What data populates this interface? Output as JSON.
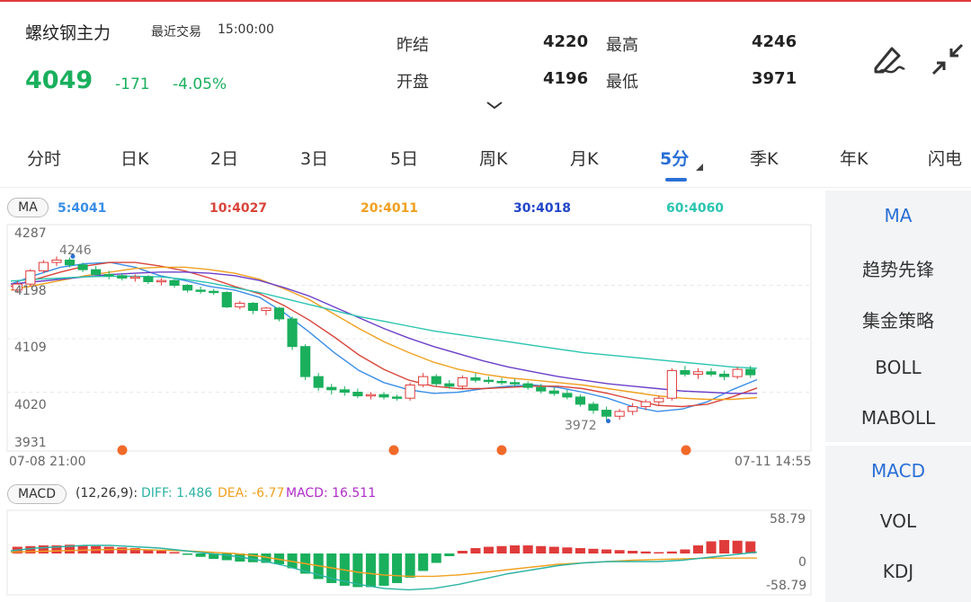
{
  "header": {
    "name": "螺纹钢主力",
    "last_trade_label": "最近交易",
    "time": "15:00:00",
    "price": "4049",
    "change": "-171",
    "change_pct": "-4.05%",
    "stats": [
      {
        "label": "昨结",
        "value": "4220"
      },
      {
        "label": "最高",
        "value": "4246"
      },
      {
        "label": "开盘",
        "value": "4196"
      },
      {
        "label": "最低",
        "value": "3971"
      }
    ],
    "colors": {
      "down": "#1aaf5d",
      "up": "#e03b3b",
      "accent": "#2a6fd6"
    },
    "icons": [
      "draw-pen-icon",
      "collapse-arrows-icon",
      "chevron-down-icon"
    ]
  },
  "tabs": [
    {
      "label": "分时"
    },
    {
      "label": "日K"
    },
    {
      "label": "2日"
    },
    {
      "label": "3日"
    },
    {
      "label": "5日"
    },
    {
      "label": "周K"
    },
    {
      "label": "月K"
    },
    {
      "label": "5分",
      "active": true
    },
    {
      "label": "季K"
    },
    {
      "label": "年K"
    },
    {
      "label": "闪电"
    }
  ],
  "ma_bar": {
    "pill": "MA",
    "values": [
      {
        "label": "5:4041",
        "color": "#3a8ee6"
      },
      {
        "label": "10:4027",
        "color": "#d8453a"
      },
      {
        "label": "20:4011",
        "color": "#f0a020"
      },
      {
        "label": "30:4018",
        "color": "#2246c8"
      },
      {
        "label": "60:4060",
        "color": "#2bc4b0"
      }
    ]
  },
  "chart_data": [
    {
      "type": "candlestick",
      "y_ticks": [
        "4287",
        "4198",
        "4109",
        "4020",
        "3931"
      ],
      "ylim": [
        3931,
        4287
      ],
      "x_start": "07-08 21:00",
      "x_end": "07-11 14:55",
      "annotations": {
        "high": "4246",
        "low": "3972"
      },
      "ohlc": [
        [
          4190,
          4205,
          4185,
          4200
        ],
        [
          4200,
          4225,
          4196,
          4222
        ],
        [
          4222,
          4240,
          4218,
          4236
        ],
        [
          4236,
          4246,
          4230,
          4240
        ],
        [
          4240,
          4244,
          4228,
          4232
        ],
        [
          4232,
          4236,
          4220,
          4224
        ],
        [
          4224,
          4230,
          4214,
          4216
        ],
        [
          4216,
          4222,
          4208,
          4214
        ],
        [
          4214,
          4218,
          4206,
          4210
        ],
        [
          4210,
          4216,
          4204,
          4212
        ],
        [
          4212,
          4215,
          4200,
          4204
        ],
        [
          4204,
          4210,
          4198,
          4206
        ],
        [
          4206,
          4208,
          4194,
          4198
        ],
        [
          4198,
          4200,
          4186,
          4190
        ],
        [
          4190,
          4196,
          4184,
          4188
        ],
        [
          4188,
          4192,
          4182,
          4186
        ],
        [
          4186,
          4188,
          4160,
          4162
        ],
        [
          4162,
          4172,
          4158,
          4168
        ],
        [
          4168,
          4170,
          4150,
          4156
        ],
        [
          4156,
          4162,
          4148,
          4160
        ],
        [
          4160,
          4162,
          4138,
          4142
        ],
        [
          4142,
          4146,
          4090,
          4096
        ],
        [
          4096,
          4100,
          4040,
          4046
        ],
        [
          4046,
          4052,
          4022,
          4028
        ],
        [
          4028,
          4034,
          4016,
          4024
        ],
        [
          4024,
          4030,
          4014,
          4020
        ],
        [
          4020,
          4026,
          4010,
          4014
        ],
        [
          4014,
          4020,
          4008,
          4016
        ],
        [
          4016,
          4020,
          4008,
          4012
        ],
        [
          4012,
          4016,
          4006,
          4010
        ],
        [
          4010,
          4036,
          4006,
          4032
        ],
        [
          4032,
          4052,
          4028,
          4046
        ],
        [
          4046,
          4050,
          4030,
          4034
        ],
        [
          4034,
          4040,
          4026,
          4030
        ],
        [
          4030,
          4048,
          4024,
          4044
        ],
        [
          4044,
          4052,
          4036,
          4040
        ],
        [
          4040,
          4046,
          4034,
          4038
        ],
        [
          4038,
          4044,
          4032,
          4036
        ],
        [
          4036,
          4042,
          4030,
          4034
        ],
        [
          4034,
          4038,
          4024,
          4028
        ],
        [
          4028,
          4034,
          4018,
          4022
        ],
        [
          4022,
          4028,
          4014,
          4018
        ],
        [
          4018,
          4024,
          4008,
          4012
        ],
        [
          4012,
          4016,
          3996,
          4000
        ],
        [
          4000,
          4004,
          3984,
          3990
        ],
        [
          3990,
          3996,
          3972,
          3980
        ],
        [
          3980,
          3992,
          3974,
          3988
        ],
        [
          3988,
          4002,
          3982,
          3996
        ],
        [
          3996,
          4008,
          3990,
          4004
        ],
        [
          4004,
          4014,
          3998,
          4010
        ],
        [
          4010,
          4060,
          4006,
          4056
        ],
        [
          4056,
          4064,
          4046,
          4050
        ],
        [
          4050,
          4060,
          4042,
          4054
        ],
        [
          4054,
          4060,
          4046,
          4050
        ],
        [
          4050,
          4056,
          4040,
          4046
        ],
        [
          4046,
          4062,
          4042,
          4058
        ],
        [
          4058,
          4064,
          4044,
          4049
        ]
      ],
      "ma": {
        "ma5": [
          4200,
          4215,
          4228,
          4234,
          4236,
          4228,
          4214,
          4206,
          4196,
          4190,
          4178,
          4152,
          4120,
          4086,
          4056,
          4036,
          4024,
          4018,
          4020,
          4026,
          4030,
          4032,
          4028,
          4020,
          4010,
          3996,
          3988,
          3992,
          4004,
          4024,
          4041
        ],
        "ma10": [
          4196,
          4208,
          4220,
          4230,
          4236,
          4236,
          4230,
          4222,
          4210,
          4196,
          4184,
          4164,
          4140,
          4112,
          4082,
          4058,
          4040,
          4030,
          4026,
          4026,
          4028,
          4030,
          4030,
          4026,
          4018,
          4008,
          3998,
          3996,
          4000,
          4012,
          4027
        ],
        "ma20": [
          4190,
          4198,
          4206,
          4214,
          4220,
          4226,
          4228,
          4228,
          4224,
          4218,
          4208,
          4192,
          4174,
          4150,
          4126,
          4104,
          4086,
          4070,
          4058,
          4050,
          4044,
          4040,
          4036,
          4032,
          4026,
          4020,
          4014,
          4010,
          4008,
          4008,
          4011
        ],
        "ma30": [
          4200,
          4204,
          4208,
          4212,
          4216,
          4218,
          4220,
          4220,
          4218,
          4214,
          4206,
          4194,
          4180,
          4162,
          4144,
          4126,
          4110,
          4096,
          4084,
          4072,
          4062,
          4054,
          4046,
          4040,
          4034,
          4030,
          4026,
          4022,
          4020,
          4018,
          4018
        ],
        "ma60": [
          4205,
          4208,
          4210,
          4212,
          4213,
          4213,
          4212,
          4208,
          4202,
          4194,
          4186,
          4176,
          4166,
          4156,
          4146,
          4138,
          4130,
          4122,
          4116,
          4110,
          4104,
          4098,
          4092,
          4086,
          4082,
          4078,
          4074,
          4070,
          4066,
          4062,
          4060
        ]
      },
      "event_markers": 4
    },
    {
      "type": "macd",
      "params": "(12,26,9):",
      "diff_label": "DIFF: 1.486",
      "dea_label": "DEA: -6.77",
      "macd_label": "MACD: 16.511",
      "y_ticks": [
        "58.79",
        "0",
        "-58.79"
      ],
      "ylim": [
        -58.79,
        58.79
      ],
      "hist": [
        10,
        11,
        12,
        12,
        13,
        12,
        11,
        10,
        9,
        8,
        6,
        4,
        2,
        -2,
        -5,
        -8,
        -10,
        -12,
        -13,
        -14,
        -16,
        -22,
        -30,
        -38,
        -44,
        -48,
        -50,
        -50,
        -48,
        -44,
        -36,
        -26,
        -14,
        -4,
        4,
        8,
        10,
        11,
        12,
        12,
        11,
        10,
        9,
        8,
        7,
        6,
        5,
        4,
        3,
        2,
        3,
        6,
        12,
        18,
        20,
        19,
        18
      ],
      "diff": [
        4,
        8,
        10,
        12,
        12,
        10,
        8,
        4,
        0,
        -4,
        -10,
        -18,
        -28,
        -38,
        -46,
        -52,
        -54,
        -52,
        -46,
        -38,
        -30,
        -24,
        -18,
        -14,
        -12,
        -12,
        -12,
        -10,
        -6,
        -2,
        2
      ],
      "dea": [
        2,
        3,
        4,
        5,
        6,
        6,
        5,
        4,
        2,
        0,
        -4,
        -10,
        -16,
        -22,
        -28,
        -32,
        -34,
        -34,
        -32,
        -28,
        -24,
        -20,
        -16,
        -14,
        -12,
        -10,
        -9,
        -8,
        -7,
        -7,
        -6.77
      ]
    }
  ],
  "macd_bar": {
    "pill": "MACD",
    "params": "(12,26,9):",
    "diff": "DIFF: 1.486",
    "dea": "DEA: -6.77",
    "macd": "MACD: 16.511",
    "diff_color": "#2bb3a3",
    "dea_color": "#f0a020",
    "macd_color": "#b02cc8"
  },
  "sidebar": {
    "main_items": [
      "MA",
      "趋势先锋",
      "集金策略",
      "BOLL",
      "MABOLL"
    ],
    "sub_items": [
      "MACD",
      "VOL",
      "KDJ"
    ]
  }
}
